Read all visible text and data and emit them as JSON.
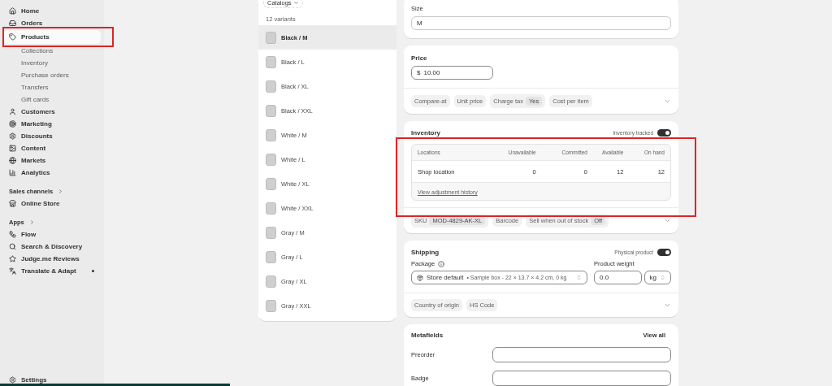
{
  "sidebar": {
    "items": [
      {
        "label": "Home",
        "kind": "main",
        "selected": false,
        "highlighted": false
      },
      {
        "label": "Orders",
        "kind": "main",
        "selected": false,
        "highlighted": false
      },
      {
        "label": "Products",
        "kind": "main",
        "selected": true,
        "highlighted": true
      },
      {
        "label": "Collections",
        "kind": "sub",
        "selected": false,
        "highlighted": false
      },
      {
        "label": "Inventory",
        "kind": "sub",
        "selected": false,
        "highlighted": false
      },
      {
        "label": "Purchase orders",
        "kind": "sub",
        "selected": false,
        "highlighted": false
      },
      {
        "label": "Transfers",
        "kind": "sub",
        "selected": false,
        "highlighted": false
      },
      {
        "label": "Gift cards",
        "kind": "sub",
        "selected": false,
        "highlighted": false
      },
      {
        "label": "Customers",
        "kind": "main",
        "selected": false,
        "highlighted": false
      },
      {
        "label": "Marketing",
        "kind": "main",
        "selected": false,
        "highlighted": false
      },
      {
        "label": "Discounts",
        "kind": "main",
        "selected": false,
        "highlighted": false
      },
      {
        "label": "Content",
        "kind": "main",
        "selected": false,
        "highlighted": false
      },
      {
        "label": "Markets",
        "kind": "main",
        "selected": false,
        "highlighted": false
      },
      {
        "label": "Analytics",
        "kind": "main",
        "selected": false,
        "highlighted": false
      },
      {
        "label": "Sales channels",
        "kind": "section",
        "selected": false,
        "highlighted": false
      },
      {
        "label": "Online Store",
        "kind": "main",
        "selected": false,
        "highlighted": false
      },
      {
        "label": "Apps",
        "kind": "section",
        "selected": false,
        "highlighted": false
      },
      {
        "label": "Flow",
        "kind": "main",
        "selected": false,
        "highlighted": false
      },
      {
        "label": "Search & Discovery",
        "kind": "main",
        "selected": false,
        "highlighted": false
      },
      {
        "label": "Judge.me Reviews",
        "kind": "main",
        "selected": false,
        "highlighted": false
      },
      {
        "label": "Translate & Adapt",
        "kind": "main",
        "selected": false,
        "highlighted": false,
        "dot": true
      }
    ],
    "settings": "Settings"
  },
  "variants": {
    "catalogs": "Catalogs",
    "count": "12 variants",
    "items": [
      {
        "label": "Black / M",
        "selected": true
      },
      {
        "label": "Black / L",
        "selected": false
      },
      {
        "label": "Black / XL",
        "selected": false
      },
      {
        "label": "Black / XXL",
        "selected": false
      },
      {
        "label": "White / M",
        "selected": false
      },
      {
        "label": "White / L",
        "selected": false
      },
      {
        "label": "White / XL",
        "selected": false
      },
      {
        "label": "White / XXL",
        "selected": false
      },
      {
        "label": "Gray / M",
        "selected": false
      },
      {
        "label": "Gray / L",
        "selected": false
      },
      {
        "label": "Gray / XL",
        "selected": false
      },
      {
        "label": "Gray / XXL",
        "selected": false
      }
    ]
  },
  "size": {
    "label": "Size",
    "value": "M"
  },
  "price": {
    "label": "Price",
    "prefix": "$",
    "value": "10.00",
    "chips": [
      {
        "label": "Compare-at"
      },
      {
        "label": "Unit price"
      },
      {
        "label": "Charge tax",
        "value": "Yes"
      },
      {
        "label": "Cost per item"
      }
    ]
  },
  "inventory": {
    "title": "Inventory",
    "toggle_label": "Inventory tracked",
    "on": true,
    "highlighted": true,
    "table": {
      "columns": [
        "Locations",
        "Unavailable",
        "Committed",
        "Available",
        "On hand"
      ],
      "rows": [
        [
          "Shop location",
          "0",
          "0",
          "12",
          "12"
        ]
      ]
    },
    "link": "View adjustment history",
    "chips": [
      {
        "label": "SKU",
        "value": "MOD-4829-AK-XL"
      },
      {
        "label": "Barcode"
      },
      {
        "label": "Sell when out of stock",
        "value": "Off"
      }
    ]
  },
  "shipping": {
    "title": "Shipping",
    "toggle_label": "Physical product",
    "on": true,
    "package_label": "Package",
    "package_name": "Store default",
    "package_detail": "• Sample box - 22 × 13.7 × 4.2 cm, 0 kg",
    "weight_label": "Product weight",
    "weight": "0.0",
    "unit": "kg",
    "chips": [
      {
        "label": "Country of origin"
      },
      {
        "label": "HS Code"
      }
    ]
  },
  "metafields": {
    "title": "Metafields",
    "view_all": "View all",
    "fields": [
      {
        "label": "Preorder"
      },
      {
        "label": "Badge"
      }
    ]
  }
}
